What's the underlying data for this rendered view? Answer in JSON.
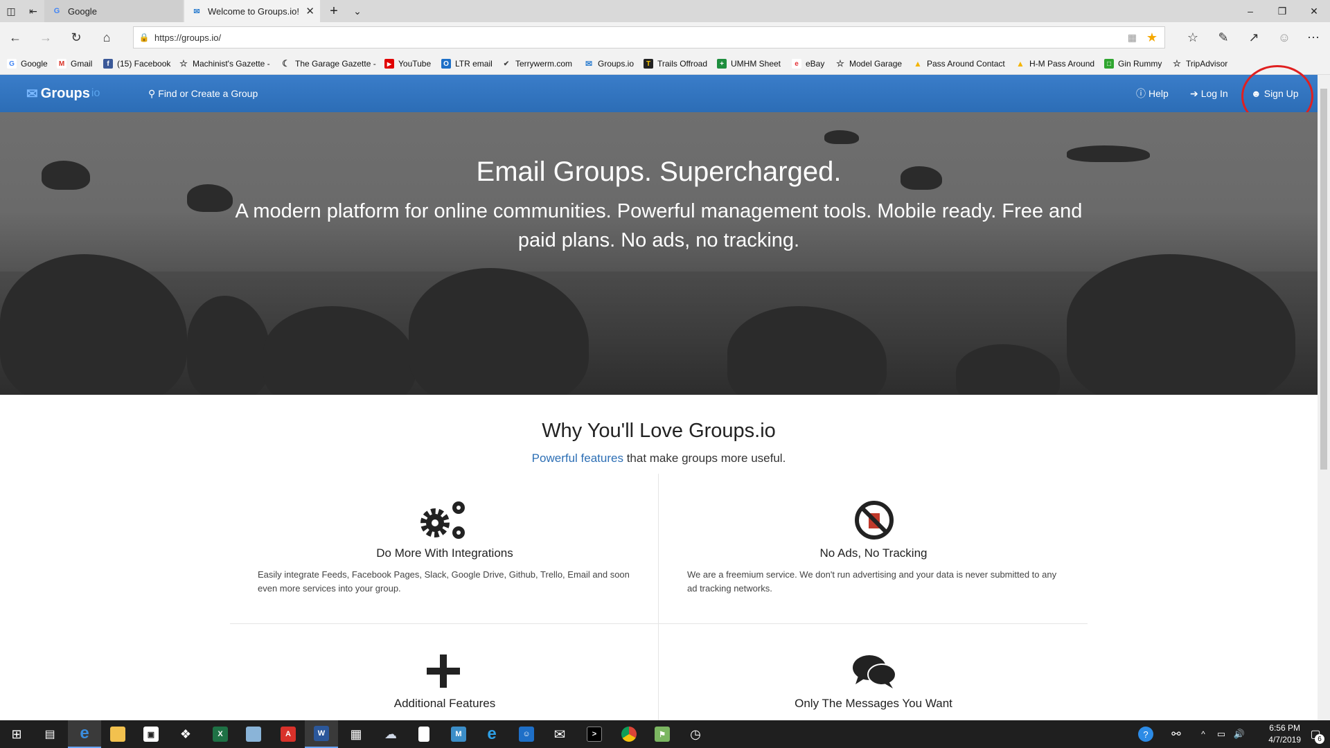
{
  "browser": {
    "tabs": [
      {
        "title": "Google",
        "active": false
      },
      {
        "title": "Welcome to Groups.io!",
        "active": true
      }
    ],
    "new_tab": "+",
    "url": "https://groups.io/"
  },
  "favorites": [
    {
      "label": "Google",
      "icon": "google-icon",
      "color": "#4285f4"
    },
    {
      "label": "Gmail",
      "icon": "gmail-icon",
      "color": "#d93025"
    },
    {
      "label": "(15) Facebook",
      "icon": "facebook-icon",
      "color": "#3b5998"
    },
    {
      "label": "Machinist's Gazette -",
      "icon": "star-icon",
      "color": "#444444"
    },
    {
      "label": "The Garage Gazette -",
      "icon": "moon-icon",
      "color": "#444444"
    },
    {
      "label": "YouTube",
      "icon": "youtube-icon",
      "color": "#e00000"
    },
    {
      "label": "LTR email",
      "icon": "outlook-icon",
      "color": "#1d6fc7"
    },
    {
      "label": "Terrywerm.com",
      "icon": "terrywerm-icon",
      "color": "#444444"
    },
    {
      "label": "Groups.io",
      "icon": "groupsio-icon",
      "color": "#2f7fd0"
    },
    {
      "label": "Trails Offroad",
      "icon": "trails-icon",
      "color": "#222222"
    },
    {
      "label": "UMHM Sheet",
      "icon": "sheets-icon",
      "color": "#1e8e3e"
    },
    {
      "label": "eBay",
      "icon": "ebay-icon",
      "color": "#e53238"
    },
    {
      "label": "Model Garage",
      "icon": "star-icon",
      "color": "#444444"
    },
    {
      "label": "Pass Around Contact",
      "icon": "drive-icon",
      "color": "#f4b400"
    },
    {
      "label": "H-M Pass Around",
      "icon": "drive-icon",
      "color": "#f4b400"
    },
    {
      "label": "Gin Rummy",
      "icon": "gin-icon",
      "color": "#2fa52f"
    },
    {
      "label": "TripAdvisor",
      "icon": "star-icon",
      "color": "#444444"
    }
  ],
  "site": {
    "logo_text": "Groups",
    "logo_suffix": "io",
    "find_group": "Find or Create a Group",
    "help": "Help",
    "login": "Log In",
    "signup": "Sign Up"
  },
  "hero": {
    "title": "Email Groups. Supercharged.",
    "subtitle": "A modern platform for online communities. Powerful management tools. Mobile ready. Free and paid plans. No ads, no tracking."
  },
  "why": {
    "title": "Why You'll Love Groups.io",
    "sub_link": "Powerful features",
    "sub_rest": " that make groups more useful."
  },
  "features": [
    {
      "title": "Do More With Integrations",
      "text": "Easily integrate Feeds, Facebook Pages, Slack, Google Drive, Github, Trello, Email and soon even more services into your group.",
      "icon": "gears-icon"
    },
    {
      "title": "No Ads, No Tracking",
      "text": "We are a freemium service. We don't run advertising and your data is never submitted to any ad tracking networks.",
      "icon": "no-ads-icon"
    },
    {
      "title": "Additional Features",
      "text": "",
      "icon": "plus-icon"
    },
    {
      "title": "Only The Messages You Want",
      "text": "",
      "icon": "chat-bubbles-icon"
    }
  ],
  "taskbar": {
    "time": "6:56 PM",
    "date": "4/7/2019",
    "notifications": "6"
  }
}
